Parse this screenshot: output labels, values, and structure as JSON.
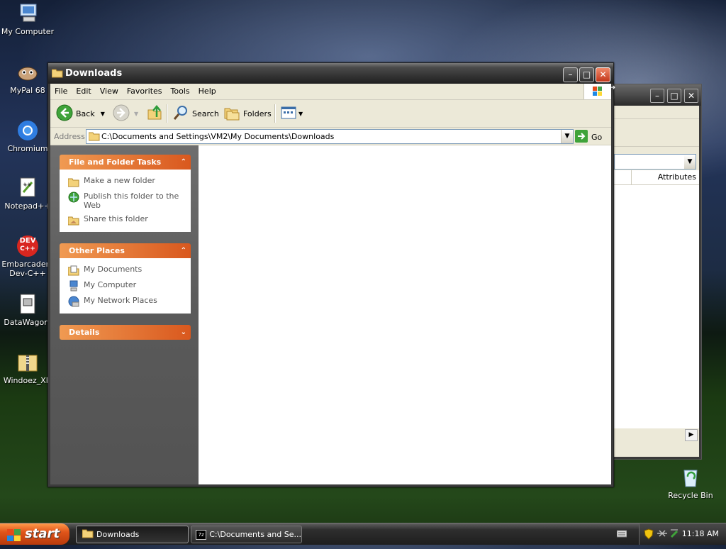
{
  "desktop": {
    "icons": [
      {
        "label": "My Computer",
        "icon": "my-computer-icon"
      },
      {
        "label": "MyPal 68",
        "icon": "mypal-icon"
      },
      {
        "label": "Chromium",
        "icon": "chromium-icon"
      },
      {
        "label": "Notepad++",
        "icon": "notepad-plus-plus-icon"
      },
      {
        "label": "Embarcadero Dev-C++",
        "icon": "dev-cpp-icon"
      },
      {
        "label": "DataWagon.",
        "icon": "datawagon-icon"
      },
      {
        "label": "Windoez_XP.",
        "icon": "zip-folder-icon"
      },
      {
        "label": "Recycle Bin",
        "icon": "recycle-bin-icon"
      }
    ],
    "dev_badge": "DEV",
    "dev_badge_sub": "C++"
  },
  "back_window": {
    "column_header": "Attributes"
  },
  "window": {
    "title": "Downloads",
    "menu": [
      "File",
      "Edit",
      "View",
      "Favorites",
      "Tools",
      "Help"
    ],
    "toolbar": {
      "back_label": "Back",
      "search_label": "Search",
      "folders_label": "Folders"
    },
    "address": {
      "label": "Address",
      "value": "C:\\Documents and Settings\\VM2\\My Documents\\Downloads",
      "go_label": "Go"
    },
    "tasks_panel": {
      "title": "File and Folder Tasks",
      "items": [
        {
          "label": "Make a new folder",
          "icon": "new-folder-icon"
        },
        {
          "label": "Publish this folder to the Web",
          "icon": "publish-web-icon"
        },
        {
          "label": "Share this folder",
          "icon": "share-folder-icon"
        }
      ]
    },
    "places_panel": {
      "title": "Other Places",
      "items": [
        {
          "label": "My Documents",
          "icon": "my-documents-icon"
        },
        {
          "label": "My Computer",
          "icon": "my-computer-icon"
        },
        {
          "label": "My Network Places",
          "icon": "network-places-icon"
        }
      ]
    },
    "details_panel": {
      "title": "Details"
    }
  },
  "taskbar": {
    "start_label": "start",
    "tasks": [
      {
        "label": "Downloads",
        "active": true
      },
      {
        "label": "C:\\Documents and Se...",
        "active": false
      }
    ],
    "clock": "11:18 AM"
  },
  "colors": {
    "panel_header": "#e06a2c",
    "link_text": "#555555",
    "start_button": "#e0551a"
  }
}
